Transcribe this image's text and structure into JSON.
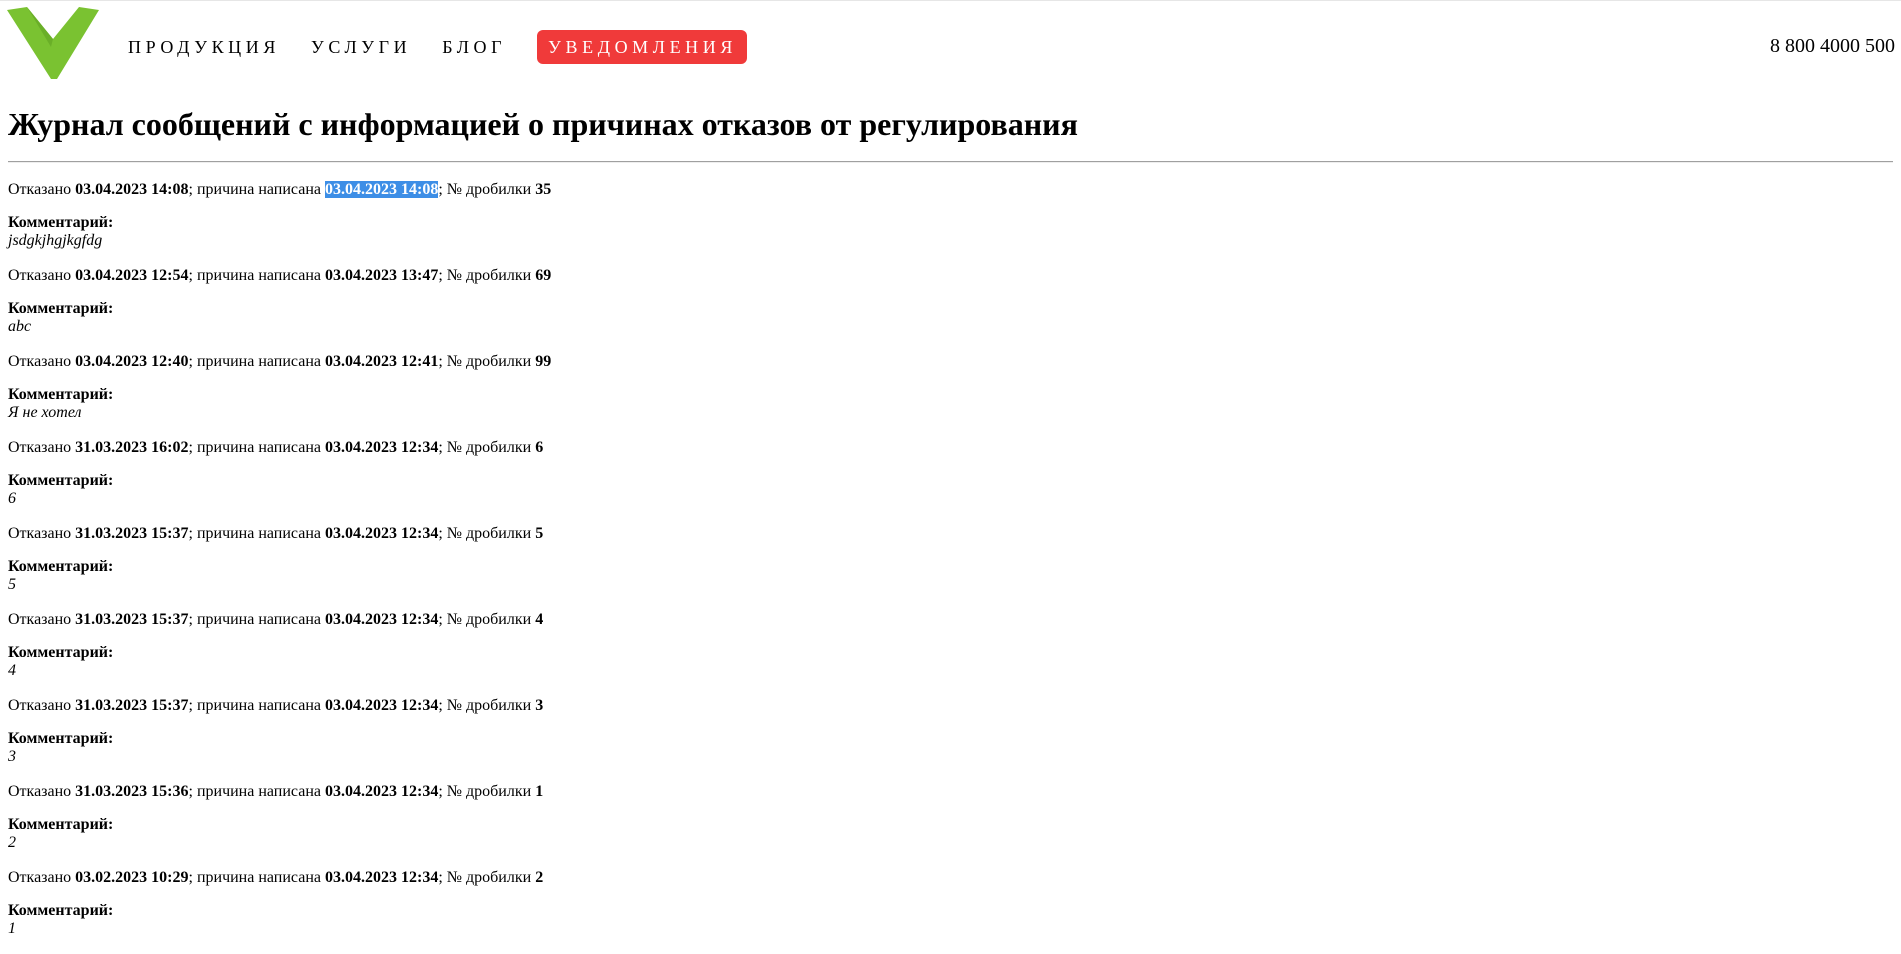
{
  "header": {
    "nav": [
      {
        "label": "ПРОДУКЦИЯ",
        "active": false
      },
      {
        "label": "УСЛУГИ",
        "active": false
      },
      {
        "label": "БЛОГ",
        "active": false
      },
      {
        "label": "УВЕДОМЛЕНИЯ",
        "active": true
      }
    ],
    "phone": "8 800 4000 500",
    "logo_icon": "green-triangle-logo",
    "colors": {
      "accent": "#f03a3a",
      "logo": "#7ac231",
      "selection": "#3d8ee6"
    }
  },
  "page_title": "Журнал сообщений с информацией о причинах отказов от регулирования",
  "labels": {
    "refused": "Отказано",
    "reason_written": "; причина написана",
    "crusher_no": "; № дробилки",
    "comment": "Комментарий:"
  },
  "entries": [
    {
      "refused_at": "03.04.2023 14:08",
      "written_at": "03.04.2023 14:08",
      "crusher": "35",
      "comment": "jsdgkjhgjkgfdg",
      "selected": true
    },
    {
      "refused_at": "03.04.2023 12:54",
      "written_at": "03.04.2023 13:47",
      "crusher": "69",
      "comment": "abc"
    },
    {
      "refused_at": "03.04.2023 12:40",
      "written_at": "03.04.2023 12:41",
      "crusher": "99",
      "comment": "Я не хотел"
    },
    {
      "refused_at": "31.03.2023 16:02",
      "written_at": "03.04.2023 12:34",
      "crusher": "6",
      "comment": "6"
    },
    {
      "refused_at": "31.03.2023 15:37",
      "written_at": "03.04.2023 12:34",
      "crusher": "5",
      "comment": "5"
    },
    {
      "refused_at": "31.03.2023 15:37",
      "written_at": "03.04.2023 12:34",
      "crusher": "4",
      "comment": "4"
    },
    {
      "refused_at": "31.03.2023 15:37",
      "written_at": "03.04.2023 12:34",
      "crusher": "3",
      "comment": "3"
    },
    {
      "refused_at": "31.03.2023 15:36",
      "written_at": "03.04.2023 12:34",
      "crusher": "1",
      "comment": "2"
    },
    {
      "refused_at": "03.02.2023 10:29",
      "written_at": "03.04.2023 12:34",
      "crusher": "2",
      "comment": "1"
    }
  ]
}
